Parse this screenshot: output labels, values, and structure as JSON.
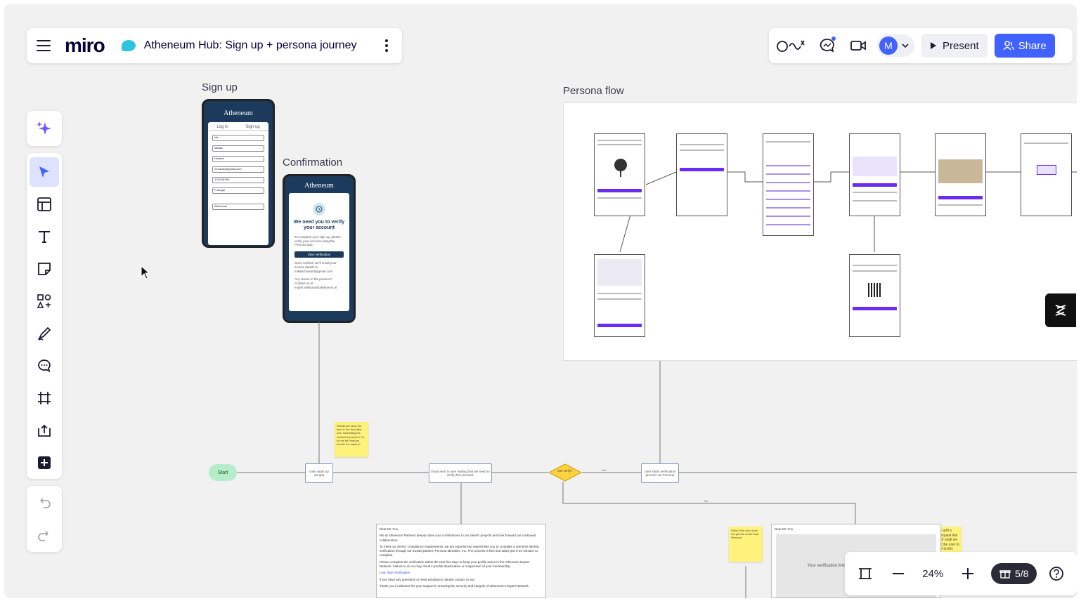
{
  "app": {
    "logo": "miro",
    "board_title": "Atheneum Hub: Sign up + persona journey"
  },
  "topbar": {
    "present_label": "Present",
    "share_label": "Share",
    "avatar_initial": "M"
  },
  "frames": {
    "signup_label": "Sign up",
    "confirmation_label": "Confirmation",
    "persona_label": "Persona flow"
  },
  "signup_phone": {
    "brand": "Atheneum",
    "tabs": [
      "Log in",
      "Sign up"
    ],
    "fields": [
      "Ms",
      "Mikala",
      "Howard",
      "mhoward@gmail.com",
      "1234 56789",
      "Portugal",
      "Atheneum"
    ]
  },
  "confirmation_phone": {
    "brand": "Atheneum",
    "heading": "We need you to verify your account",
    "body": "To complete your sign up, please verify your account using the Persona app.",
    "button": "Start verification",
    "note": "Once verified, we'll email your access details to mikala.howard@gmail.com",
    "help": "Any issues in the process? Contact us at expert.relations@atheneum.ai"
  },
  "flow": {
    "start": "Start",
    "step1": "User signs up via app",
    "step2": "Email sent to user inviting that we need to verify their account.",
    "decision": "Did verify?",
    "step3": "User starts verification process via Persona",
    "yes_label": "Yes",
    "no_label": "No"
  },
  "sticky_notes": {
    "note1": "Should we keep the time in the flow after user submitting the verified document? Or do we let Persona handle the inquiry?",
    "note2": "What if the user does not get the email? Ask Persona",
    "note3": "Can we add a direct request link here? Or shall we just ask the user to respond to this email?"
  },
  "email_doc": {
    "greeting": "Dear Mr. Fox,",
    "p1": "We at Atheneum Partners deeply value your contributions to our clients' projects and look forward our continued collaboration.",
    "p2": "To meet our clients' compliance requirements, we are experienced experts like you to complete a one-time identity verification through our trusted partner, Persona Identities, Inc. The process is free and takes just 5-10 minutes to complete.",
    "p3": "Please complete the verification within the next five days to keep your profile active in the Atheneum Expert Network. Failure to do so may result in profile deactivation or suspension of your membership.",
    "link": "Link: Start Verification",
    "p4": "If you have any questions or need assistance, please contact us via",
    "p5": "Thank you in advance for your support in ensuring the security and integrity of Atheneum's Expert Network."
  },
  "email_doc2": {
    "greeting": "Dear Mr. Fox,",
    "body": "Your verification link failed, please reply to this email"
  },
  "bottombar": {
    "zoom": "24%",
    "pages": "5/8"
  },
  "colors": {
    "accent": "#4262ff",
    "sticky": "#fff27a",
    "start": "#b5ecc9",
    "decision": "#ffd23f",
    "persona_purple": "#6a2cf0"
  }
}
